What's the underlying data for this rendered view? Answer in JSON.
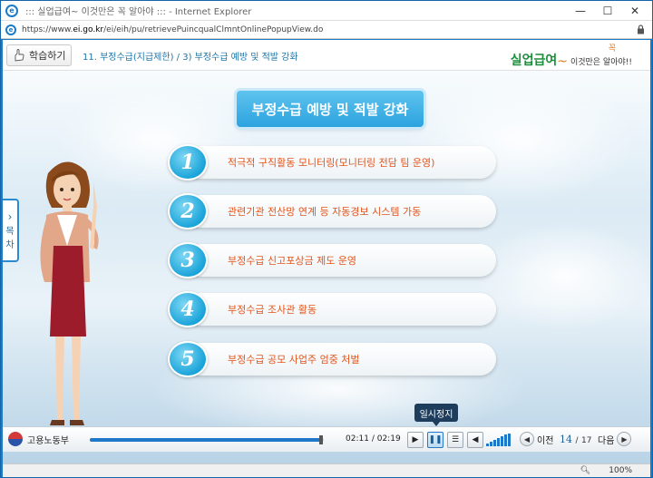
{
  "window": {
    "title": "::: 실업급여~ 이것만은 꼭 알아야 ::: - Internet Explorer",
    "url_prefix": "https://www.",
    "url_domain": "ei.go.kr",
    "url_path": "/ei/eih/pu/retrievePuincqualClmntOnlinePopupView.do",
    "minimize": "—",
    "maximize": "☐",
    "close": "✕"
  },
  "header": {
    "learn_button": "학습하기",
    "breadcrumb": "11. 부정수급(지급제한) / 3) 부정수급 예방 및 적발 강화",
    "brand_main": "실업급여",
    "brand_tilde": "~",
    "brand_sub": "이것만은 알아야!!",
    "brand_mark": "꼭"
  },
  "main": {
    "heading": "부정수급 예방 및 적발 강화",
    "items": [
      {
        "num": "1",
        "text": "적극적 구직활동 모니터링(모니터링 전담 팀 운영)"
      },
      {
        "num": "2",
        "text": "관련기관 전산망 연계 등 자동경보 시스템 가동"
      },
      {
        "num": "3",
        "text": "부정수급 신고포상금 제도 운영"
      },
      {
        "num": "4",
        "text": "부정수급 조사관 활동"
      },
      {
        "num": "5",
        "text": "부정수급 공모 사업주 엄중 처벌"
      }
    ],
    "toc_label_1": "목",
    "toc_label_2": "차"
  },
  "player": {
    "org_name": "고용노동부",
    "progress": 0.99,
    "time_current": "02:11",
    "time_sep": "/",
    "time_total": "02:19",
    "tooltip": "일시정지",
    "prev_label": "이전",
    "next_label": "다음",
    "page_current": "14",
    "page_sep": "/",
    "page_total": "17"
  },
  "statusbar": {
    "zoom": "100%"
  },
  "colors": {
    "accent": "#1b7bc6",
    "item_text": "#e2551c",
    "heading_bg": "#2ba3df",
    "brand_green": "#1b8e3c"
  }
}
